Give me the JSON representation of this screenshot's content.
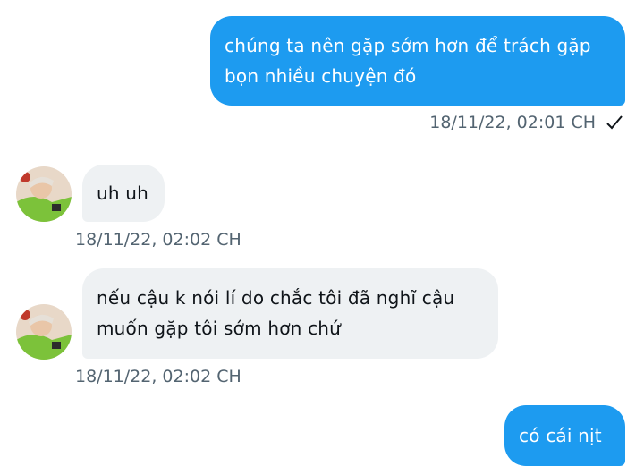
{
  "messages": [
    {
      "direction": "outgoing",
      "text": "chúng ta nên gặp sớm hơn để trách gặp bọn nhiều chuyện đó",
      "time": "18/11/22,  02:01 CH",
      "status_icon": "check-icon"
    },
    {
      "direction": "incoming",
      "text": "uh uh",
      "time": "18/11/22,  02:02 CH",
      "avatar": "avatar"
    },
    {
      "direction": "incoming",
      "text": "nếu cậu k nói lí do chắc tôi đã nghĩ cậu muốn gặp tôi sớm hơn chứ",
      "time": "18/11/22,  02:02 CH",
      "avatar": "avatar"
    },
    {
      "direction": "outgoing",
      "text": "có cái nịt"
    }
  ],
  "colors": {
    "outgoing_bubble": "#1d9bf0",
    "incoming_bubble": "#eef1f3",
    "meta_text": "#536471"
  }
}
